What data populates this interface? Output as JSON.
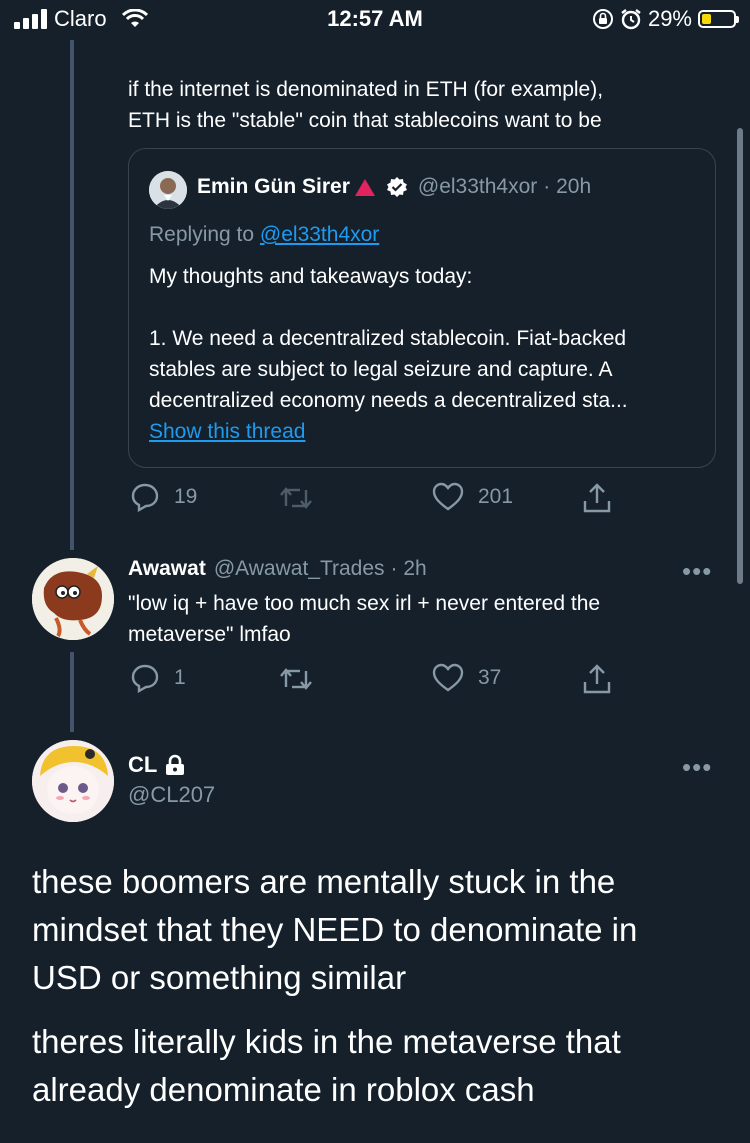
{
  "status_bar": {
    "carrier": "Claro",
    "time": "12:57 AM",
    "battery_percent": "29%",
    "battery_level": 0.29,
    "battery_color": "#f5d90a"
  },
  "tweet_reply": {
    "text_line1": "if the internet is denominated in ETH (for example),",
    "text_line2": "ETH is the \"stable\" coin that stablecoins want to be",
    "quoted": {
      "author_name": "Emin Gün Sirer",
      "author_handle": "@el33th4xor",
      "time": "· 20h",
      "replying_prefix": "Replying to ",
      "replying_handle": "@el33th4xor",
      "line1": "My thoughts and takeaways today:",
      "line2": "1. We need a decentralized stablecoin. Fiat-backed",
      "line3": "stables are subject to legal seizure and capture. A",
      "line4": "decentralized economy needs a decentralized sta...",
      "show_thread": "Show this thread"
    },
    "actions": {
      "replies": "19",
      "likes": "201"
    }
  },
  "tweet_awawat": {
    "author_name": "Awawat",
    "author_handle": "@Awawat_Trades",
    "time": "· 2h",
    "more": "•••",
    "line1": "\"low iq + have too much sex irl + never entered the",
    "line2": "metaverse\" lmfao",
    "actions": {
      "replies": "1",
      "likes": "37"
    }
  },
  "tweet_cl": {
    "author_name": "CL",
    "author_handle": "@CL207",
    "more": "•••",
    "line1": "these boomers are mentally stuck in the",
    "line2": "mindset that they NEED to denominate in",
    "line3": "USD or something similar",
    "line4": "theres literally kids in the metaverse that",
    "line5": "already denominate in roblox cash"
  },
  "colors": {
    "background": "#15202b",
    "muted": "#8899a6",
    "link": "#1d9bf0",
    "verified": "#ffffff",
    "warning_triangle": "#e0245e"
  },
  "icons": [
    "signal-icon",
    "wifi-icon",
    "orientation-lock-icon",
    "alarm-icon",
    "battery-icon",
    "verified-badge-icon",
    "red-triangle-icon",
    "lock-icon",
    "reply-icon",
    "retweet-icon",
    "like-icon",
    "share-icon",
    "more-icon"
  ]
}
